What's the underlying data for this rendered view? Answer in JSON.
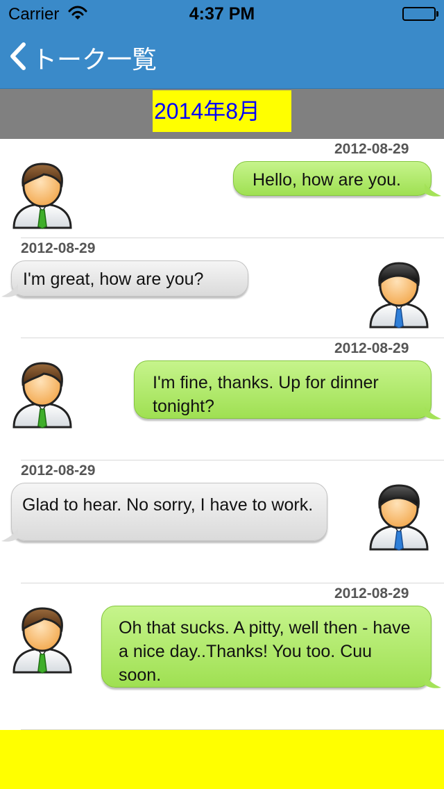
{
  "status_bar": {
    "carrier": "Carrier",
    "time": "4:37 PM"
  },
  "nav": {
    "back_label": "トーク一覧"
  },
  "month_header": {
    "label": "2014年8月"
  },
  "messages": [
    {
      "date": "2012-08-29",
      "text": "Hello, how are you.",
      "side": "right",
      "bubble_color": "green"
    },
    {
      "date": "2012-08-29",
      "text": "I'm great, how are you?",
      "side": "left",
      "bubble_color": "gray"
    },
    {
      "date": "2012-08-29",
      "text": "I'm fine, thanks. Up for dinner tonight?",
      "side": "right",
      "bubble_color": "green"
    },
    {
      "date": "2012-08-29",
      "text": "Glad to hear. No sorry, I have to work.",
      "side": "left",
      "bubble_color": "gray"
    },
    {
      "date": "2012-08-29",
      "text": "Oh that sucks. A pitty, well then - have a nice day..Thanks! You too. Cuu soon.",
      "side": "right",
      "bubble_color": "green"
    }
  ],
  "colors": {
    "nav_background": "#3a8ac9",
    "month_bar": "#808080",
    "month_label_background": "#ffff00",
    "month_label_text": "#0000ff",
    "bubble_green": "#a8e45e",
    "bubble_gray": "#e4e4e4",
    "footer": "#ffff00"
  },
  "icons": {
    "back": "chevron-left-icon",
    "wifi": "wifi-icon",
    "battery": "battery-icon",
    "avatar_brown_hair": "user-avatar-green-tie",
    "avatar_black_hair": "user-avatar-blue-tie"
  }
}
